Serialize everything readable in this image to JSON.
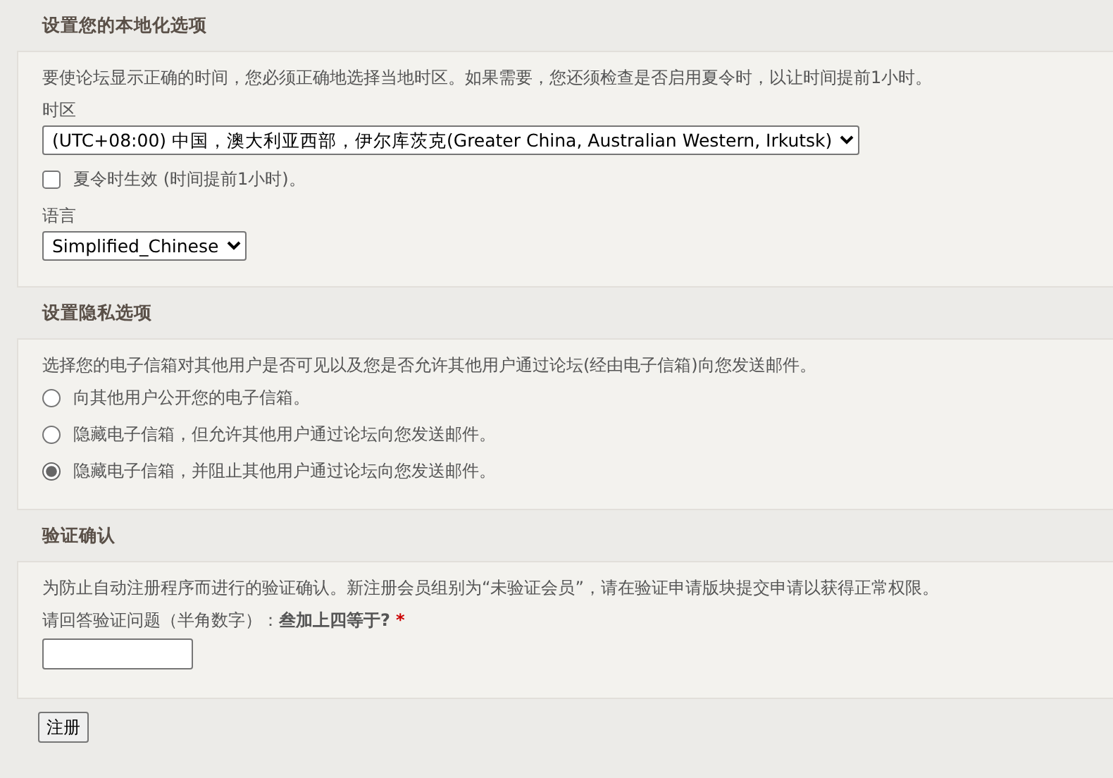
{
  "sections": [
    {
      "title": "设置您的本地化选项",
      "description": "要使论坛显示正确的时间，您必须正确地选择当地时区。如果需要，您还须检查是否启用夏令时，以让时间提前1小时。",
      "fields": [
        {
          "kind": "select",
          "label": "时区",
          "value": "(UTC+08:00) 中国，澳大利亚西部，伊尔库茨克(Greater China, Australian Western, Irkutsk)"
        },
        {
          "kind": "checkbox",
          "label": "夏令时生效 (时间提前1小时)。",
          "checked": false
        },
        {
          "kind": "select",
          "label": "语言",
          "value": "Simplified_Chinese"
        }
      ]
    },
    {
      "title": "设置隐私选项",
      "description": "选择您的电子信箱对其他用户是否可见以及您是否允许其他用户通过论坛(经由电子信箱)向您发送邮件。",
      "fields": [
        {
          "kind": "radio",
          "label": "向其他用户公开您的电子信箱。",
          "selected": false
        },
        {
          "kind": "radio",
          "label": "隐藏电子信箱，但允许其他用户通过论坛向您发送邮件。",
          "selected": false
        },
        {
          "kind": "radio",
          "label": "隐藏电子信箱，并阻止其他用户通过论坛向您发送邮件。",
          "selected": true
        }
      ]
    },
    {
      "title": "验证确认",
      "description": "为防止自动注册程序而进行的验证确认。新注册会员组别为“未验证会员”，请在验证申请版块提交申请以获得正常权限。",
      "fields": [
        {
          "kind": "question",
          "label": "请回答验证问题（半角数字）：**叁加上四等于?**",
          "required_mark": "*"
        }
      ]
    }
  ],
  "submit_button": "注册"
}
